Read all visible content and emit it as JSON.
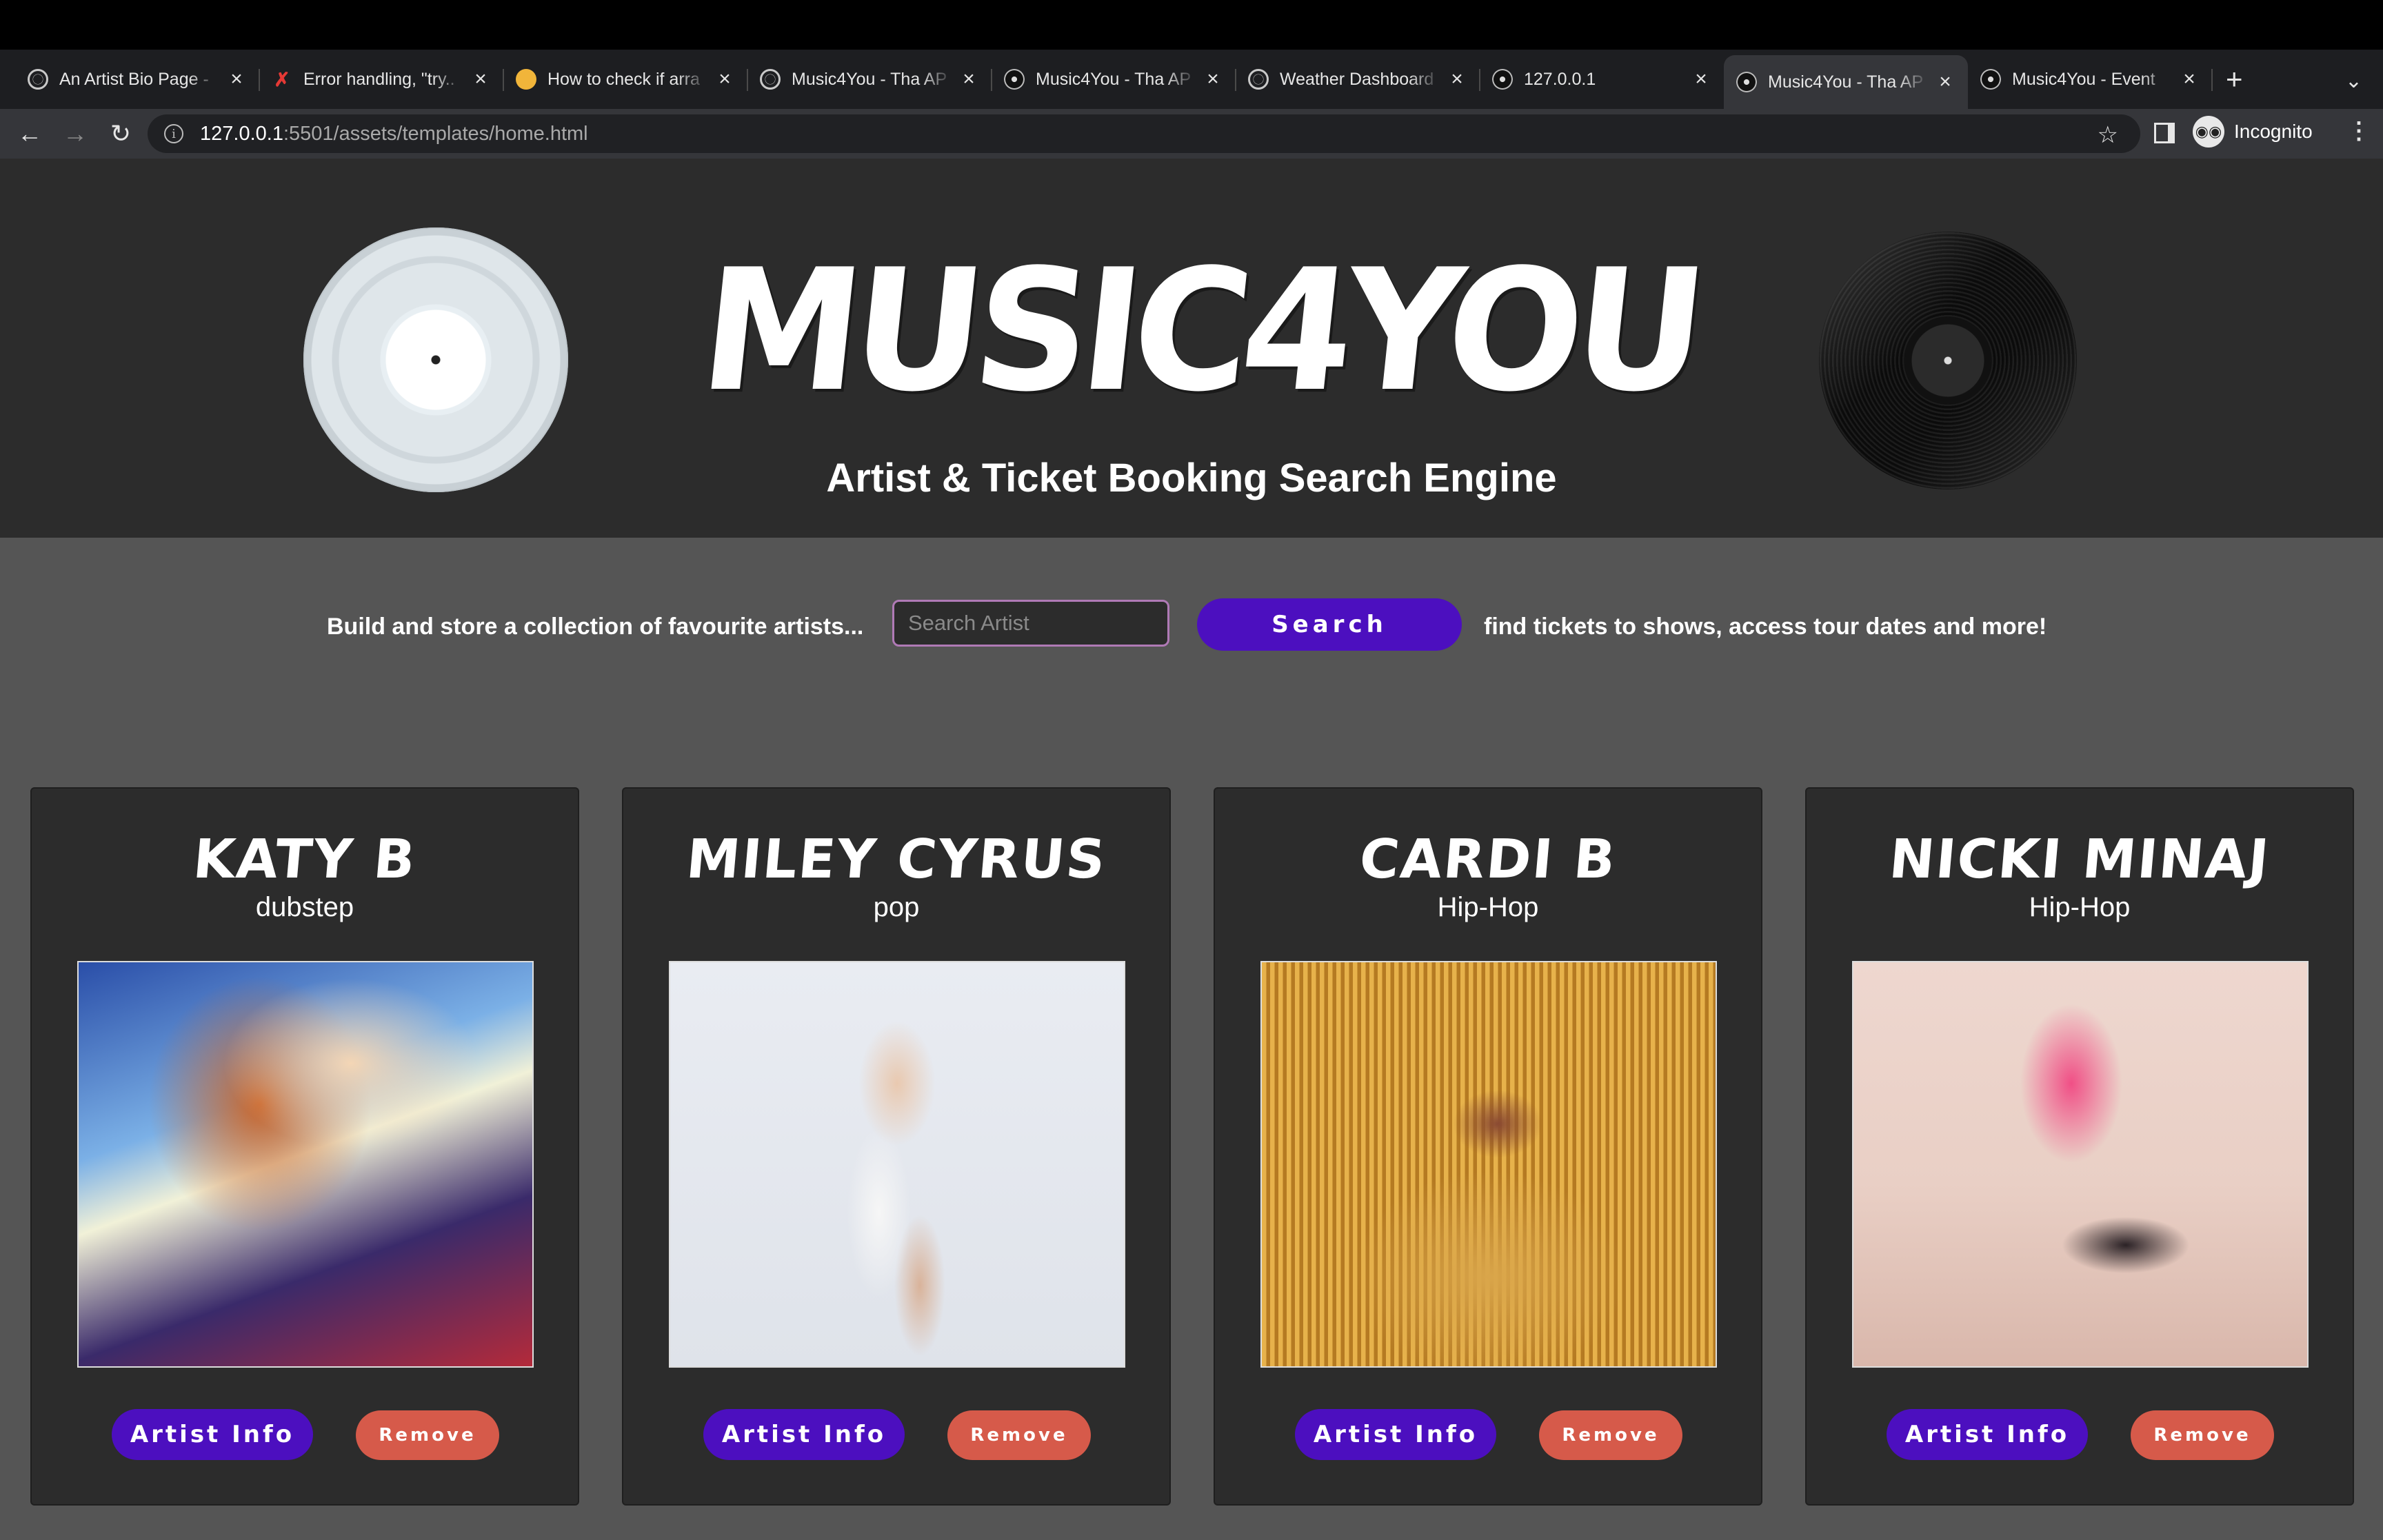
{
  "browser": {
    "tabs": [
      {
        "title": "An Artist Bio Page -",
        "icon": "globe-icon",
        "active": false
      },
      {
        "title": "Error handling, \"try..",
        "icon": "x-mark-icon",
        "active": false
      },
      {
        "title": "How to check if arra",
        "icon": "owl-icon",
        "active": false
      },
      {
        "title": "Music4You - Tha AP",
        "icon": "globe-icon",
        "active": false
      },
      {
        "title": "Music4You - Tha AP",
        "icon": "vinyl-icon",
        "active": false
      },
      {
        "title": "Weather Dashboard",
        "icon": "globe-icon",
        "active": false
      },
      {
        "title": "127.0.0.1",
        "icon": "vinyl-icon",
        "active": false
      },
      {
        "title": "Music4You - Tha AP",
        "icon": "vinyl-icon",
        "active": true
      },
      {
        "title": "Music4You - Event",
        "icon": "vinyl-icon",
        "active": false
      }
    ],
    "url_host": "127.0.0.1",
    "url_path": ":5501/assets/templates/home.html",
    "profile_label": "Incognito"
  },
  "hero": {
    "logo": "MUSIC4YOU",
    "tagline": "Artist & Ticket Booking Search Engine"
  },
  "search": {
    "left_copy": "Build and store a collection of favourite artists...",
    "placeholder": "Search Artist",
    "button_label": "Search",
    "right_copy": "find tickets to shows, access tour dates and more!"
  },
  "artists": [
    {
      "name": "KATY B",
      "genre": "dubstep",
      "info_label": "Artist Info",
      "remove_label": "Remove"
    },
    {
      "name": "MILEY CYRUS",
      "genre": "pop",
      "info_label": "Artist Info",
      "remove_label": "Remove"
    },
    {
      "name": "CARDI B",
      "genre": "Hip-Hop",
      "info_label": "Artist Info",
      "remove_label": "Remove"
    },
    {
      "name": "NICKI MINAJ",
      "genre": "Hip-Hop",
      "info_label": "Artist Info",
      "remove_label": "Remove"
    }
  ],
  "colors": {
    "accent_purple": "#4c0fbf",
    "remove_red": "#d65a4a",
    "panel_bg": "#2c2c2c",
    "page_bg": "#555555"
  }
}
